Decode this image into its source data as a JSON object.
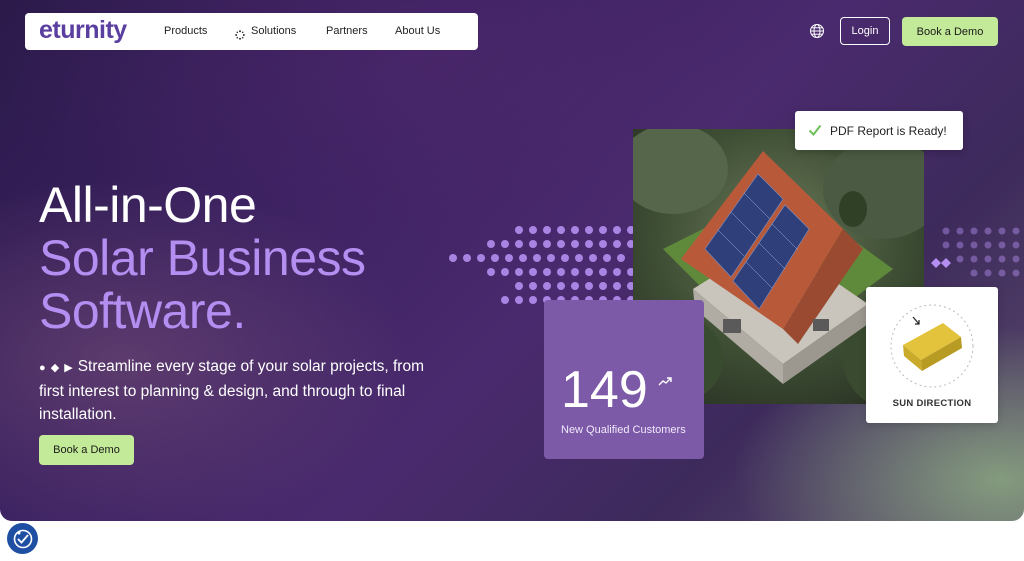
{
  "nav": {
    "logo": "eturnity",
    "items": [
      "Products",
      "Solutions",
      "Partners",
      "About Us"
    ]
  },
  "header": {
    "language_icon": "globe-icon",
    "login_label": "Login",
    "demo_label": "Book a Demo"
  },
  "hero": {
    "title_line1": "All-in-One",
    "title_line2": "Solar Business",
    "title_line3": "Software.",
    "description": "Streamline every stage of your solar projects, from first interest to planning & design, and through to final installation.",
    "bullet_glyphs": "● ◆ ▶",
    "cta_label": "Book a Demo"
  },
  "stats": {
    "number": "149",
    "label": "New Qualified Customers"
  },
  "notification": {
    "text": "PDF Report is Ready!"
  },
  "sun_card": {
    "label": "SUN DIRECTION"
  },
  "colors": {
    "accent_purple": "#b48ef0",
    "brand_purple": "#5b3fa0",
    "cta_green": "#c3ea98",
    "stats_bg": "#7c5aa8"
  }
}
